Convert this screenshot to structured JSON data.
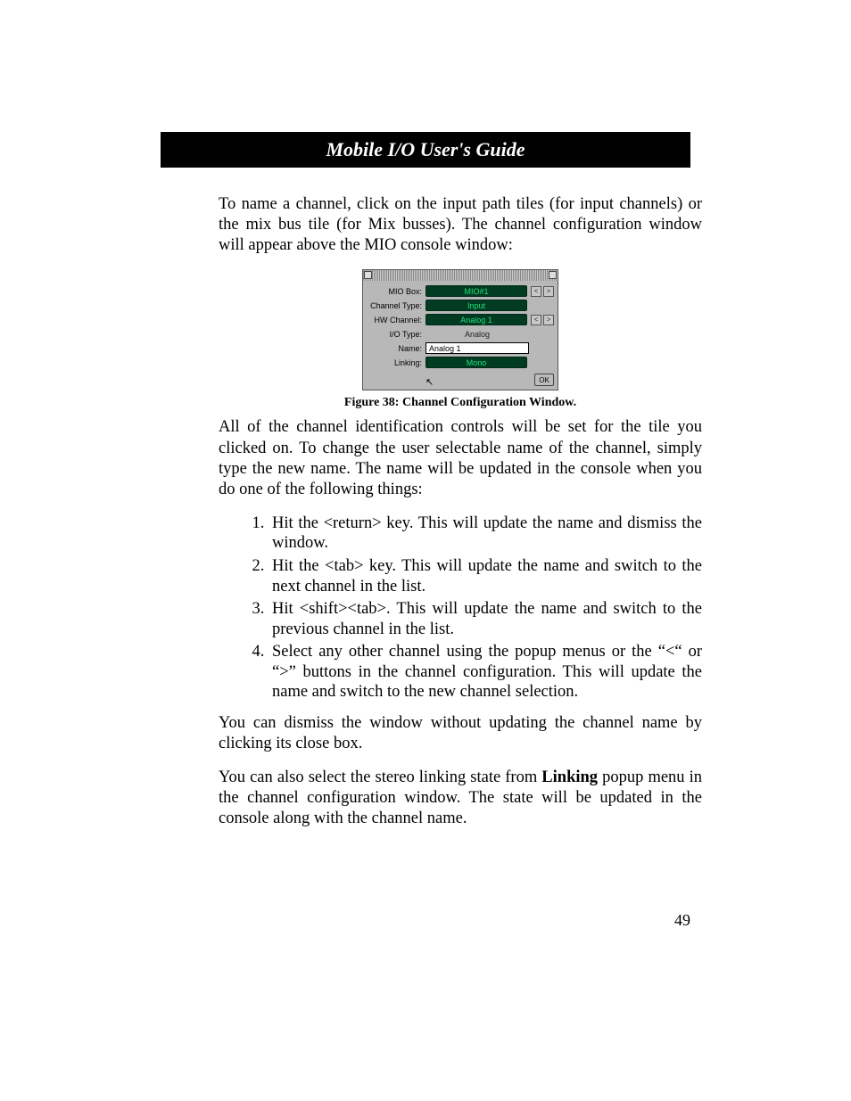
{
  "header": {
    "title": "Mobile I/O User's Guide"
  },
  "para1": "To name a channel, click on the input path tiles (for input channels) or the mix bus tile (for Mix busses). The channel configuration window will appear above the MIO console window:",
  "figure": {
    "caption": "Figure 38: Channel Configuration Window.",
    "rows": {
      "mio_box": {
        "label": "MIO Box:",
        "value": "MIO#1"
      },
      "channel_type": {
        "label": "Channel Type:",
        "value": "Input"
      },
      "hw_channel": {
        "label": "HW Channel:",
        "value": "Analog 1"
      },
      "io_type": {
        "label": "I/O Type:",
        "value": "Analog"
      },
      "name": {
        "label": "Name:",
        "value": "Analog 1"
      },
      "linking": {
        "label": "Linking:",
        "value": "Mono"
      }
    },
    "ok_label": "OK",
    "prev_glyph": "<",
    "next_glyph": ">"
  },
  "para2": "All of the channel identification controls will be set for the tile you clicked on. To change the user selectable name of the channel, simply type the new name. The name will be updated in the console when you do one of the following things:",
  "steps": [
    "Hit the <return> key. This will update the name and dismiss the window.",
    "Hit the <tab> key. This will update the name and switch to the next channel in the list.",
    "Hit <shift><tab>. This will update the name and switch to the previous channel in the list.",
    "Select any other channel using the popup menus or the “<“ or “>” buttons in the channel configuration. This will update the name and switch to the new channel selection."
  ],
  "para3": "You can dismiss the window without updating the channel name by clicking its close box.",
  "para4a": "You can also select the stereo linking state from ",
  "para4b": "Linking",
  "para4c": " popup menu in the channel configuration window. The state will be updated in the console along with the channel name.",
  "page_number": "49"
}
